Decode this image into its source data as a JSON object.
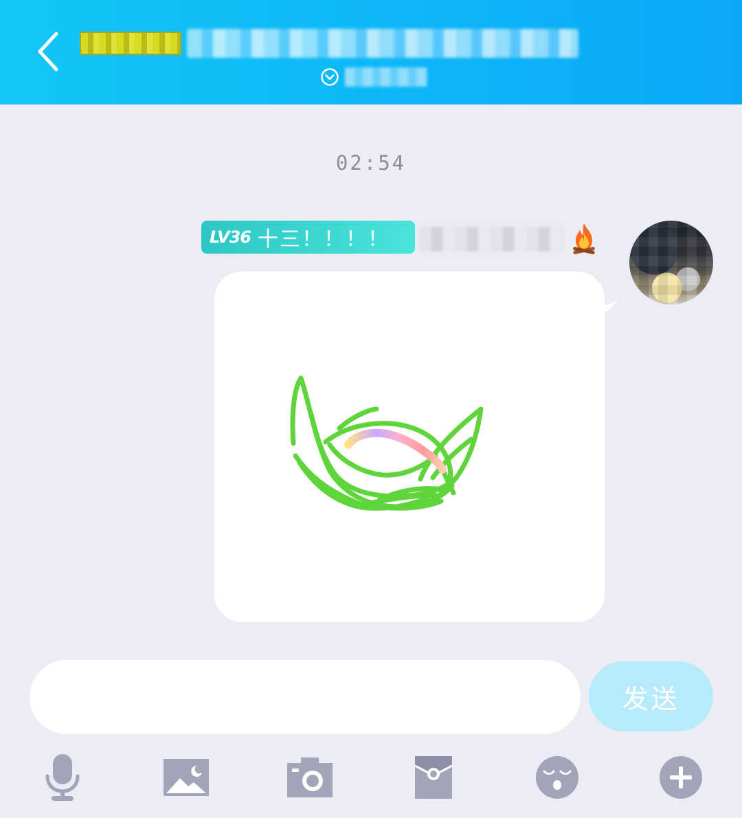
{
  "chat": {
    "timestamp": "02:54"
  },
  "message": {
    "level_label": "LV36",
    "honor_title": "十三！！！！"
  },
  "composer": {
    "input_value": "",
    "send_label": "发送"
  },
  "toolbar": {
    "icons": [
      "microphone-icon",
      "image-icon",
      "camera-icon",
      "red-packet-icon",
      "emoji-icon",
      "plus-icon"
    ]
  },
  "colors": {
    "header_start": "#12c6f7",
    "header_end": "#0aa9f7",
    "background": "#ececf4",
    "badge_start": "#2cc7c4",
    "badge_end": "#49e4dc",
    "send_button": "#b7ebfb",
    "toolbar_icon": "#a3a4b8",
    "doodle_stroke": "#5fd43b"
  }
}
